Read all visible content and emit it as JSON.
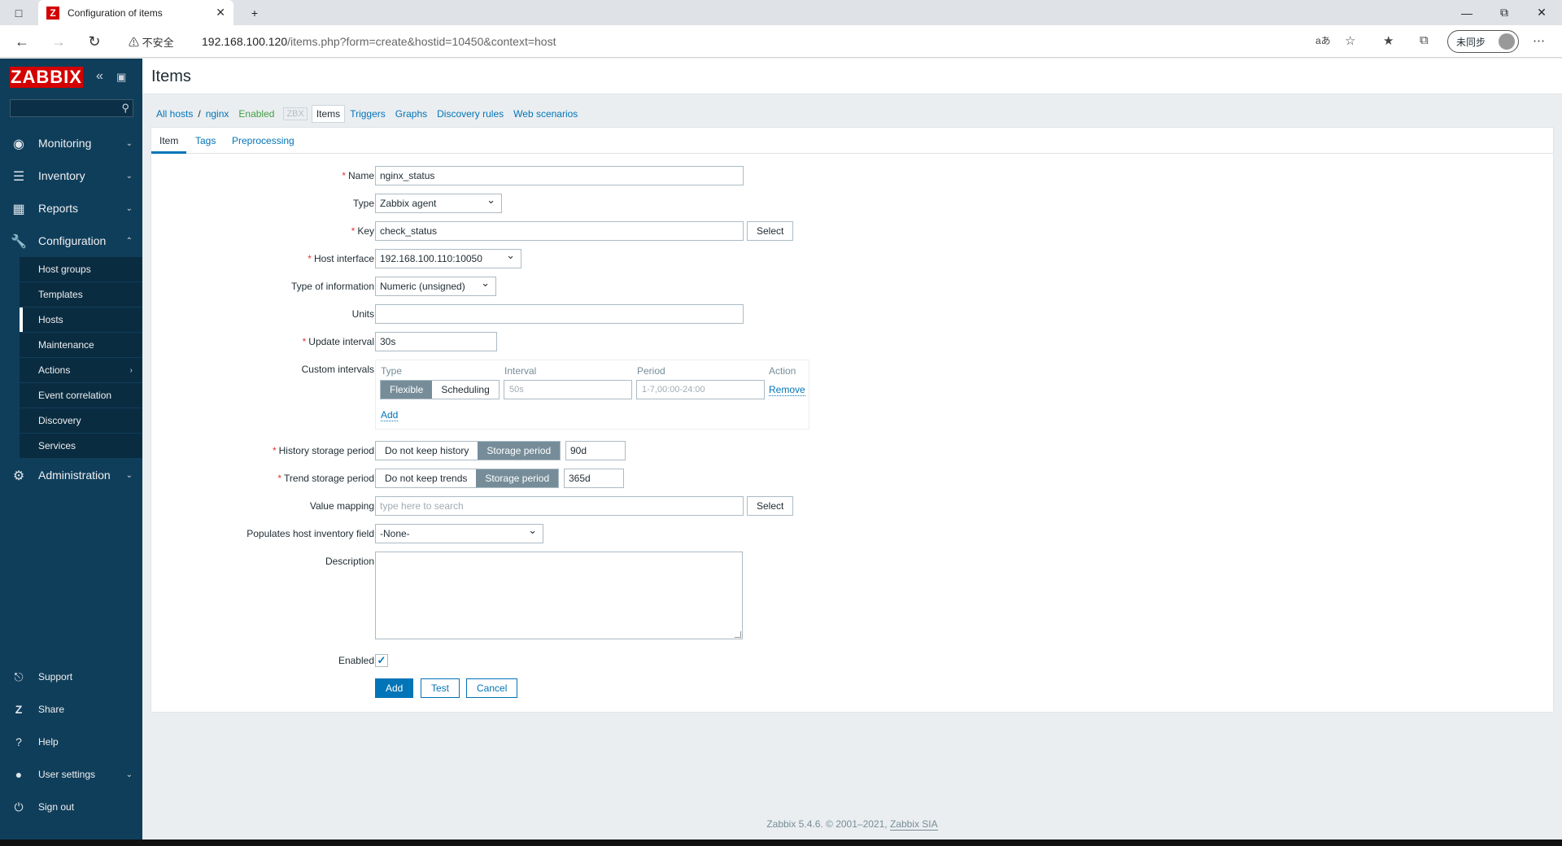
{
  "browser": {
    "tab_title": "Configuration of items",
    "tab_icon": "Z",
    "security_label": "不安全",
    "url_host": "192.168.100.120",
    "url_path": "/items.php?form=create&hostid=10450&context=host",
    "sync_label": "未同步"
  },
  "sidebar": {
    "logo": "ZABBIX",
    "menu": [
      {
        "label": "Monitoring",
        "icon": "eye-icon"
      },
      {
        "label": "Inventory",
        "icon": "list-icon"
      },
      {
        "label": "Reports",
        "icon": "chart-icon"
      },
      {
        "label": "Configuration",
        "icon": "wrench-icon"
      },
      {
        "label": "Administration",
        "icon": "gear-icon"
      }
    ],
    "config_sub": [
      "Host groups",
      "Templates",
      "Hosts",
      "Maintenance",
      "Actions",
      "Event correlation",
      "Discovery",
      "Services"
    ],
    "bottom": [
      {
        "label": "Support",
        "icon": "headset-icon"
      },
      {
        "label": "Share",
        "icon": "share-icon"
      },
      {
        "label": "Help",
        "icon": "help-icon"
      },
      {
        "label": "User settings",
        "icon": "user-icon"
      },
      {
        "label": "Sign out",
        "icon": "power-icon"
      }
    ]
  },
  "page": {
    "title": "Items",
    "breadcrumbs": {
      "all_hosts": "All hosts",
      "sep": "/",
      "host": "nginx",
      "status": "Enabled",
      "zbx": "ZBX",
      "items": "Items",
      "triggers": "Triggers",
      "graphs": "Graphs",
      "discovery": "Discovery rules",
      "web": "Web scenarios"
    },
    "tabs": [
      "Item",
      "Tags",
      "Preprocessing"
    ]
  },
  "form": {
    "name": {
      "label": "Name",
      "value": "nginx_status"
    },
    "type": {
      "label": "Type",
      "value": "Zabbix agent"
    },
    "key": {
      "label": "Key",
      "value": "check_status",
      "select": "Select"
    },
    "host_interface": {
      "label": "Host interface",
      "value": "192.168.100.110:10050"
    },
    "type_of_info": {
      "label": "Type of information",
      "value": "Numeric (unsigned)"
    },
    "units": {
      "label": "Units",
      "value": ""
    },
    "update_interval": {
      "label": "Update interval",
      "value": "30s"
    },
    "custom_intervals": {
      "label": "Custom intervals",
      "headers": {
        "type": "Type",
        "interval": "Interval",
        "period": "Period",
        "action": "Action"
      },
      "flexible": "Flexible",
      "scheduling": "Scheduling",
      "interval_placeholder": "50s",
      "period_placeholder": "1-7,00:00-24:00",
      "remove": "Remove",
      "add": "Add"
    },
    "history": {
      "label": "History storage period",
      "opt_off": "Do not keep history",
      "opt_on": "Storage period",
      "value": "90d"
    },
    "trend": {
      "label": "Trend storage period",
      "opt_off": "Do not keep trends",
      "opt_on": "Storage period",
      "value": "365d"
    },
    "value_mapping": {
      "label": "Value mapping",
      "placeholder": "type here to search",
      "select": "Select"
    },
    "inventory": {
      "label": "Populates host inventory field",
      "value": "-None-"
    },
    "description": {
      "label": "Description"
    },
    "enabled": {
      "label": "Enabled",
      "checked": true
    },
    "buttons": {
      "add": "Add",
      "test": "Test",
      "cancel": "Cancel"
    }
  },
  "footer": {
    "text": "Zabbix 5.4.6. © 2001–2021, ",
    "link": "Zabbix SIA"
  }
}
